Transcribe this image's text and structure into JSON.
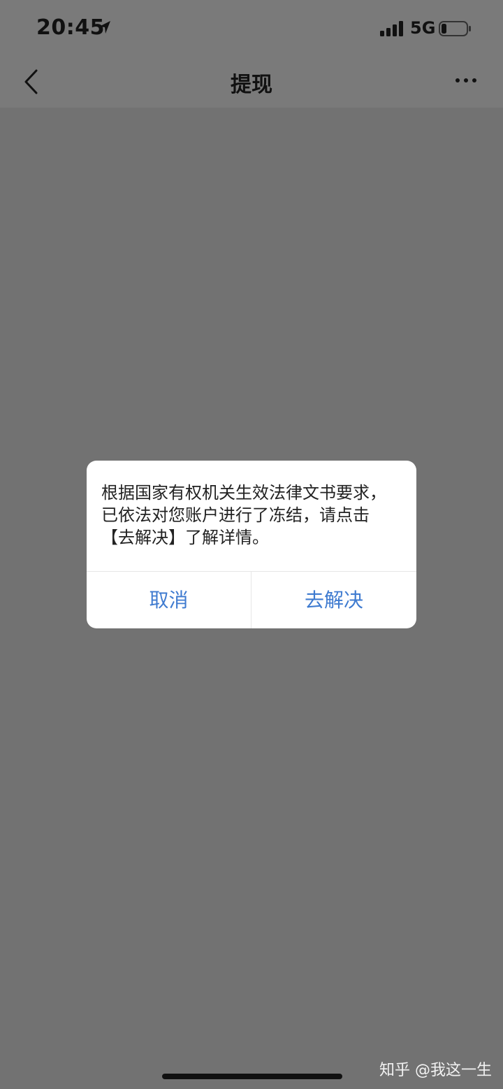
{
  "status_bar": {
    "time": "20:45",
    "network": "5G",
    "icons": [
      "location-arrow-icon",
      "signal-bars-icon",
      "battery-icon"
    ]
  },
  "nav": {
    "title": "提现",
    "icons": [
      "back-chevron-icon",
      "more-dots-icon"
    ]
  },
  "dialog": {
    "message": "根据国家有权机关生效法律文书要求，已依法对您账户进行了冻结，请点击【去解决】了解详情。",
    "cancel_label": "取消",
    "resolve_label": "去解决"
  },
  "watermark": "知乎 @我这一生",
  "colors": {
    "overlay_background": "#727272",
    "dialog_background": "#ffffff",
    "button_text": "#3f7bd0"
  }
}
